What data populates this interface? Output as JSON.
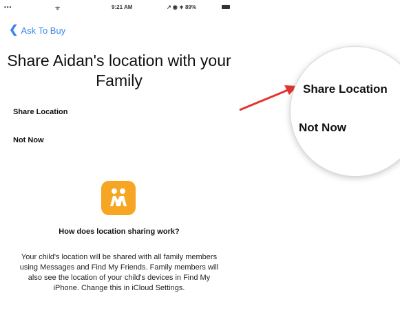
{
  "status_bar": {
    "signal": "•••",
    "wifi": "ᯤ",
    "time": "9:21 AM",
    "right": "↗ ◉ ∗ 89%"
  },
  "nav": {
    "back_label": "Ask To Buy"
  },
  "title": "Share Aidan's location with your Family",
  "options": {
    "share": "Share Location",
    "not_now": "Not Now"
  },
  "info": {
    "heading": "How does location sharing work?",
    "body": "Your child's location will be shared with all family members using Messages and Find My Friends. Family members will also see the location of your child's devices in Find My iPhone. Change this in iCloud Settings."
  },
  "callout": {
    "share": "Share Location",
    "not_now": "Not Now"
  },
  "colors": {
    "accent": "#3a86e6",
    "icon_bg": "#f6a623",
    "arrow": "#e2352f"
  }
}
